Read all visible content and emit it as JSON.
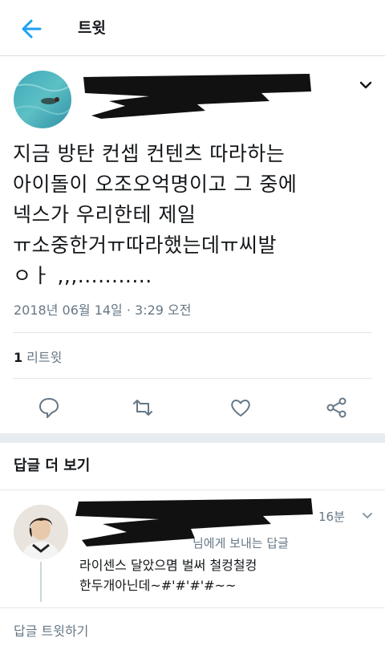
{
  "header": {
    "title": "트윗"
  },
  "tweet": {
    "text": "지금 방탄 컨셉 컨텐츠 따라하는\n아이돌이 오조오억명이고 그 중에\n넥스가 우리한테 제일\nㅠ소중한거ㅠ따라했는데ㅠ씨발\nㅇㅏ ,,,...........",
    "timestamp": "2018년 06월 14일 · 3:29 오전",
    "retweet_count": "1",
    "retweet_label": "리트윗"
  },
  "actions": {
    "reply_icon": "speech-bubble-icon",
    "retweet_icon": "retweet-arrows-icon",
    "like_icon": "heart-icon",
    "share_icon": "share-nodes-icon"
  },
  "more_replies": {
    "title": "답글 더 보기"
  },
  "reply": {
    "time": "16분",
    "replying_to": "님에게 보내는 답글",
    "text": "라이센스 달았으몀 벌써 철컹철컹\n한두개아닌데~#'#'#'#~~"
  },
  "compose": {
    "placeholder": "답글 트윗하기"
  },
  "colors": {
    "accent": "#1da1f2",
    "muted": "#657786",
    "text": "#14171a",
    "divider": "#e1e8ed"
  }
}
